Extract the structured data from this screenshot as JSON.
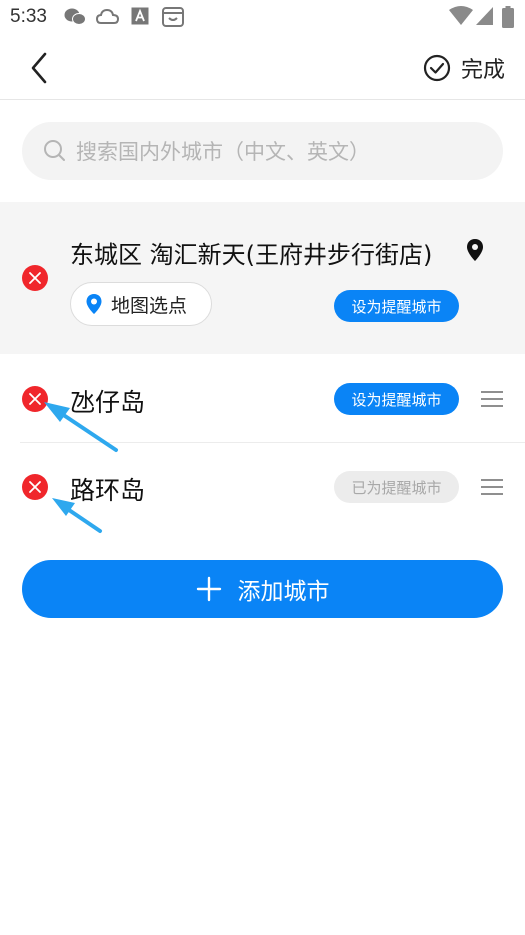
{
  "status_bar": {
    "time": "5:33",
    "icons": [
      "wechat-icon",
      "weather-cloud-icon",
      "font-a-icon",
      "smile-bag-icon",
      "wifi-icon",
      "signal-icon",
      "battery-icon"
    ]
  },
  "header": {
    "done_label": "完成"
  },
  "search": {
    "placeholder": "搜索国内外城市（中文、英文）"
  },
  "current_location": {
    "title": "东城区 淘汇新天(王府井步行街店)",
    "map_pick_label": "地图选点",
    "set_reminder_label": "设为提醒城市"
  },
  "cities": [
    {
      "name": "氹仔岛",
      "action_label": "设为提醒城市",
      "is_reminder": false
    },
    {
      "name": "路环岛",
      "action_label": "已为提醒城市",
      "is_reminder": true
    }
  ],
  "add_city": {
    "label": "添加城市"
  },
  "colors": {
    "accent": "#0a84f6",
    "remove": "#f0262b",
    "arrow": "#2ea8ee"
  }
}
